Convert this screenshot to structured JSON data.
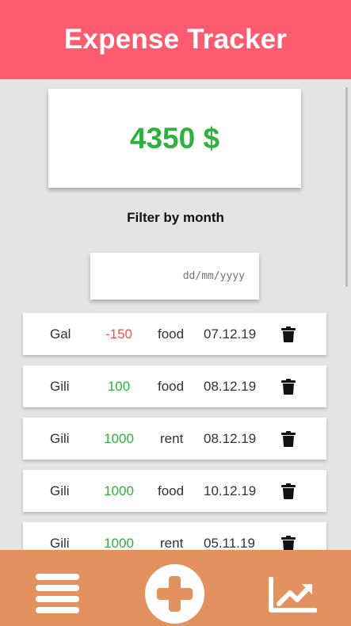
{
  "app": {
    "title": "Expense Tracker"
  },
  "summary": {
    "total": "4350 $"
  },
  "filter": {
    "label": "Filter by month",
    "date_placeholder": "dd/mm/yyyy"
  },
  "colors": {
    "header": "#fd5c70",
    "footer": "#e3925f",
    "positive": "#2fb13f",
    "negative": "#ef5350"
  },
  "expenses": [
    {
      "name": "Gal",
      "amount": "-150",
      "category": "food",
      "date": "07.12.19",
      "sign": "negative"
    },
    {
      "name": "Gili",
      "amount": "100",
      "category": "food",
      "date": "08.12.19",
      "sign": "positive"
    },
    {
      "name": "Gili",
      "amount": "1000",
      "category": "rent",
      "date": "08.12.19",
      "sign": "positive"
    },
    {
      "name": "Gili",
      "amount": "1000",
      "category": "food",
      "date": "10.12.19",
      "sign": "positive"
    },
    {
      "name": "Gili",
      "amount": "1000",
      "category": "rent",
      "date": "05.11.19",
      "sign": "positive"
    }
  ],
  "footer": {
    "icons": [
      "menu-icon",
      "plus-icon",
      "chart-line-icon"
    ]
  }
}
